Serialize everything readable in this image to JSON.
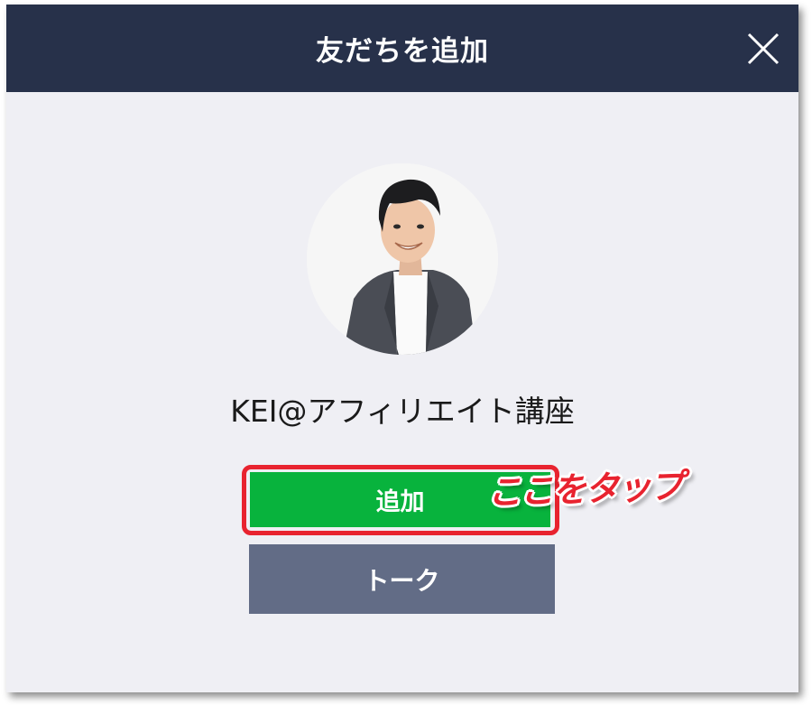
{
  "dialog": {
    "title": "友だちを追加",
    "close_icon": "close-icon"
  },
  "profile": {
    "name": "KEI@アフィリエイト講座",
    "avatar_icon": "person-avatar"
  },
  "actions": {
    "add_label": "追加",
    "talk_label": "トーク"
  },
  "annotation": {
    "text": "ここをタップ",
    "color": "#e8232f"
  },
  "colors": {
    "header_bg": "#27314a",
    "body_bg": "#efeff4",
    "add_button": "#08b33d",
    "talk_button": "#626c86"
  }
}
